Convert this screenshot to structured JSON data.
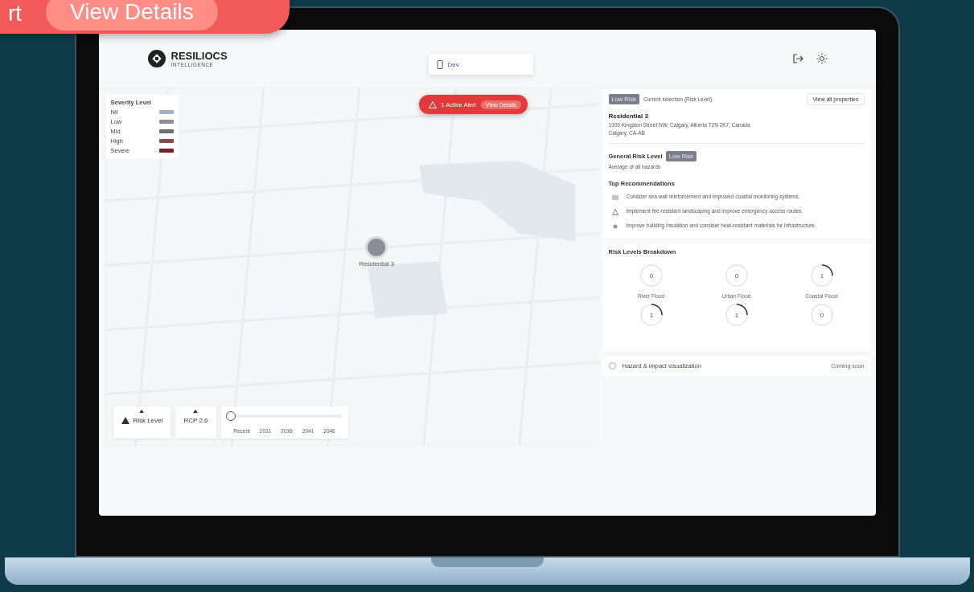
{
  "promo": {
    "text": "rt",
    "button": "View Details"
  },
  "header": {
    "brand": "RESILIOCS",
    "tagline": "INTELLIGENCE",
    "environment": "Dev"
  },
  "map": {
    "legend": {
      "title": "Severity Level",
      "items": [
        {
          "label": "Nil",
          "color": "#9fb3c8"
        },
        {
          "label": "Low",
          "color": "#8a9099"
        },
        {
          "label": "Mid",
          "color": "#6e6e6e"
        },
        {
          "label": "High",
          "color": "#8b4a4a"
        },
        {
          "label": "Severe",
          "color": "#7a1f28"
        }
      ]
    },
    "alert": {
      "text": "1 Active Alert",
      "button": "View Details"
    },
    "marker": {
      "label": "Residential 3"
    },
    "controls": {
      "layer": "Risk Level",
      "scenario": "RCP 2.6",
      "timeline": {
        "level": 0,
        "ticks": [
          "Recent",
          "2031",
          "2036",
          "2041",
          "2046"
        ]
      }
    }
  },
  "panel": {
    "badge": "Low Risk",
    "selection": "Current selection (Risk Level)",
    "view_all": "View all properties",
    "property": {
      "name": "Residential 3",
      "address": "1309 Kingston Street NW, Calgary, Alberta T2N 2K7, Canada",
      "region": "Calgary, CA-AB"
    },
    "general": {
      "title": "General Risk Level",
      "badge": "Low Risk",
      "subtitle": "Average of all hazards"
    },
    "recommendations": {
      "title": "Top Recommendations",
      "items": [
        {
          "kind": "water",
          "text": "Consider sea wall reinforcement and improved coastal monitoring systems."
        },
        {
          "kind": "fire",
          "text": "Implement fire-resistant landscaping and improve emergency access routes."
        },
        {
          "kind": "heat",
          "text": "Improve building insulation and consider heat-resistant materials for infrastructure."
        }
      ]
    },
    "breakdown": {
      "title": "Risk Levels Breakdown",
      "items": [
        {
          "value": "0",
          "level": 0,
          "label": "River Flood"
        },
        {
          "value": "0",
          "level": 0,
          "label": "Urban Flood"
        },
        {
          "value": "1",
          "level": 0.25,
          "label": "Coastal Flood"
        },
        {
          "value": "1",
          "level": 0.25
        },
        {
          "value": "1",
          "level": 0.25
        },
        {
          "value": "0",
          "level": 0
        }
      ]
    },
    "hazard": {
      "title": "Hazard & impact visualization",
      "status": "Coming soon"
    }
  }
}
